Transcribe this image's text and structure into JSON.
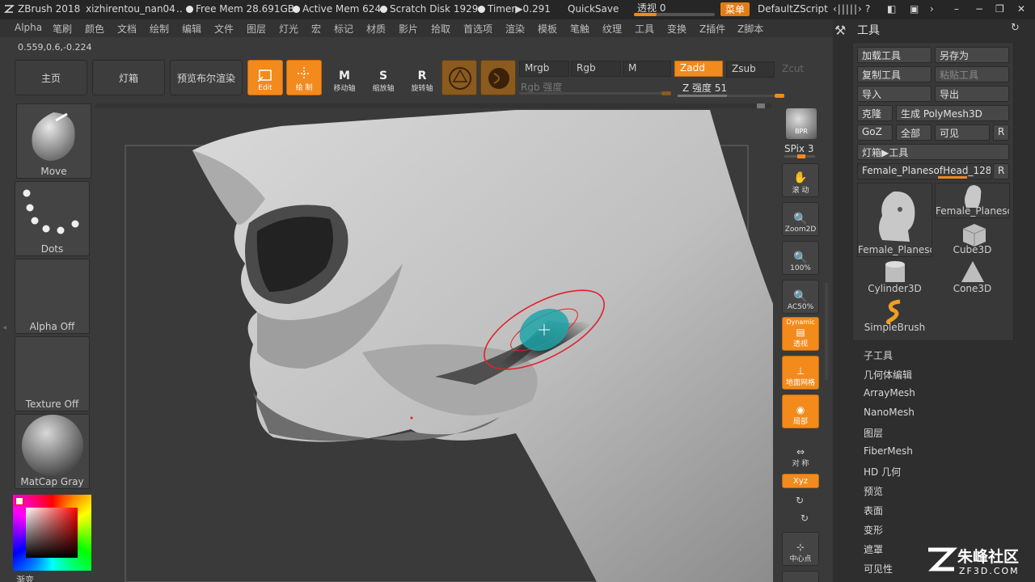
{
  "titlebar": {
    "app": "ZBrush 2018",
    "file": "xizhirentou_nan04",
    "ellipsis": "..",
    "free_mem": "Free Mem 28.691GB",
    "active_mem": "Active Mem 624",
    "scratch": "Scratch Disk 1929",
    "timer": "Timer▶0.291",
    "quicksave": "QuickSave",
    "perspective": "透视  0",
    "menu": "菜单",
    "script": "DefaultZScript"
  },
  "menubar": [
    "Alpha",
    "笔刷",
    "颜色",
    "文档",
    "绘制",
    "编辑",
    "文件",
    "图层",
    "灯光",
    "宏",
    "标记",
    "材质",
    "影片",
    "拾取",
    "首选项",
    "渲染",
    "模板",
    "笔触",
    "纹理",
    "工具",
    "变换",
    "Z插件",
    "Z脚本"
  ],
  "coords": "0.559,0.6,-0.224",
  "shelf": {
    "home": "主页",
    "lightbox": "灯箱",
    "bpr": "预览布尔渲染",
    "edit": "Edit",
    "draw": "绘 制",
    "move": "移动轴",
    "scale": "缩放轴",
    "rotate": "旋转轴",
    "mrgb": "Mrgb",
    "rgb": "Rgb",
    "m": "M",
    "zadd": "Zadd",
    "zsub": "Zsub",
    "zcut": "Zcut",
    "rgb_intensity": "Rgb 强度",
    "z_intensity": "Z 强度 51",
    "z_intensity_value": 51
  },
  "lefttray": {
    "brush": "Move",
    "stroke": "Dots",
    "alpha": "Alpha Off",
    "texture": "Texture Off",
    "material": "MatCap Gray",
    "gradient": "渐变"
  },
  "rightstrip": {
    "bpr": "BPR",
    "spix": "SPix 3",
    "scroll": "滚 动",
    "zoom2d": "Zoom2D",
    "hundred": "100%",
    "ac50": "AC50%",
    "dynamic": "Dynamic",
    "persp": "透视",
    "floor": "地面网格",
    "local": "局部",
    "sym": "对 称",
    "xyz": "Xyz",
    "center": "中心点"
  },
  "toolpanel": {
    "title": "工具",
    "load": "加载工具",
    "saveas": "另存为",
    "copy": "复制工具",
    "paste": "粘贴工具",
    "import": "导入",
    "export": "导出",
    "clone": "克隆",
    "polymesh": "生成 PolyMesh3D",
    "goz": "GoZ",
    "all": "全部",
    "visible": "可见",
    "r": "R",
    "lightbox_tool": "灯箱▶工具",
    "current_tool": "Female_PlanesofHead_128.",
    "thumbs": [
      "Female_Planesc",
      "Female_Planesc",
      "Cube3D",
      "Cylinder3D",
      "Cone3D",
      "SimpleBrush"
    ],
    "subpalettes": [
      "子工具",
      "几何体编辑",
      "ArrayMesh",
      "NanoMesh",
      "图层",
      "FiberMesh",
      "HD 几何",
      "预览",
      "表面",
      "变形",
      "遮罩",
      "可见性"
    ]
  },
  "watermark": {
    "cn": "朱峰社区",
    "en": "ZF3D.COM"
  },
  "colors": {
    "accent": "#f28a1c",
    "cursor_ring": "#e0222a",
    "brush_core": "#1fa3a8"
  }
}
